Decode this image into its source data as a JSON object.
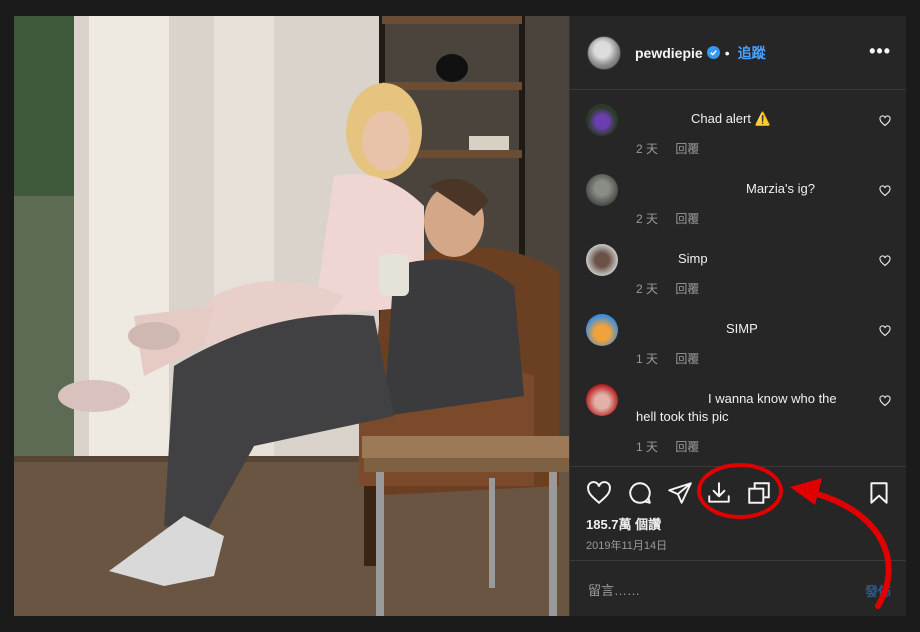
{
  "post": {
    "username": "pewdiepie",
    "follow_label": "追蹤",
    "more_label": "•••",
    "separator": "•"
  },
  "comments": [
    {
      "text": "Chad alert ⚠️",
      "age": "2 天",
      "reply": "回覆"
    },
    {
      "text": "Marzia's ig?",
      "age": "2 天",
      "reply": "回覆"
    },
    {
      "text": "Simp",
      "age": "2 天",
      "reply": "回覆"
    },
    {
      "text": "SIMP",
      "age": "1 天",
      "reply": "回覆"
    },
    {
      "text": "I wanna know who the hell took this pic",
      "age": "1 天",
      "reply": "回覆"
    }
  ],
  "stats": {
    "views": "185.7萬 個讚",
    "date": "2019年11月14日"
  },
  "add_comment": {
    "placeholder": "留言……",
    "post_label": "發佈"
  },
  "colors": {
    "accent": "#4aa3ff",
    "annotation": "#e00000",
    "panel_bg": "#262626"
  },
  "icons": [
    "heart-icon",
    "comment-icon",
    "share-icon",
    "download-icon",
    "copy-icon",
    "bookmark-icon",
    "verified-badge-icon"
  ]
}
